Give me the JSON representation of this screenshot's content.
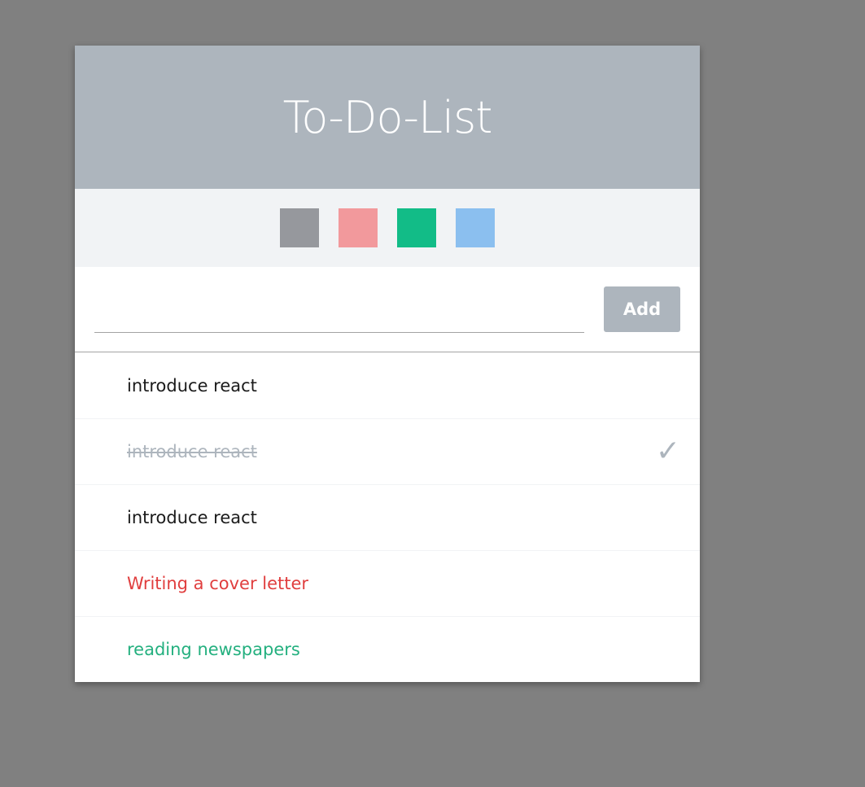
{
  "header": {
    "title": "To-Do-List"
  },
  "palette": {
    "colors": [
      "#96989d",
      "#f2999c",
      "#12bc87",
      "#8bbfef"
    ]
  },
  "form": {
    "input_value": "",
    "input_placeholder": "",
    "add_label": "Add"
  },
  "todos": [
    {
      "text": "introduce react",
      "done": false,
      "color": "#1b1b1b"
    },
    {
      "text": "introduce react",
      "done": true,
      "color": "#adb5bd",
      "check": "✓"
    },
    {
      "text": "introduce react",
      "done": false,
      "color": "#1b1b1b"
    },
    {
      "text": "Writing a cover letter",
      "done": false,
      "color": "#e03e3e"
    },
    {
      "text": "reading newspapers",
      "done": false,
      "color": "#24b07f"
    }
  ],
  "theme": {
    "header_bg": "#adb5bd",
    "palette_bg": "#f1f3f5",
    "backdrop": "#808080",
    "check_color": "#adb5bd"
  }
}
